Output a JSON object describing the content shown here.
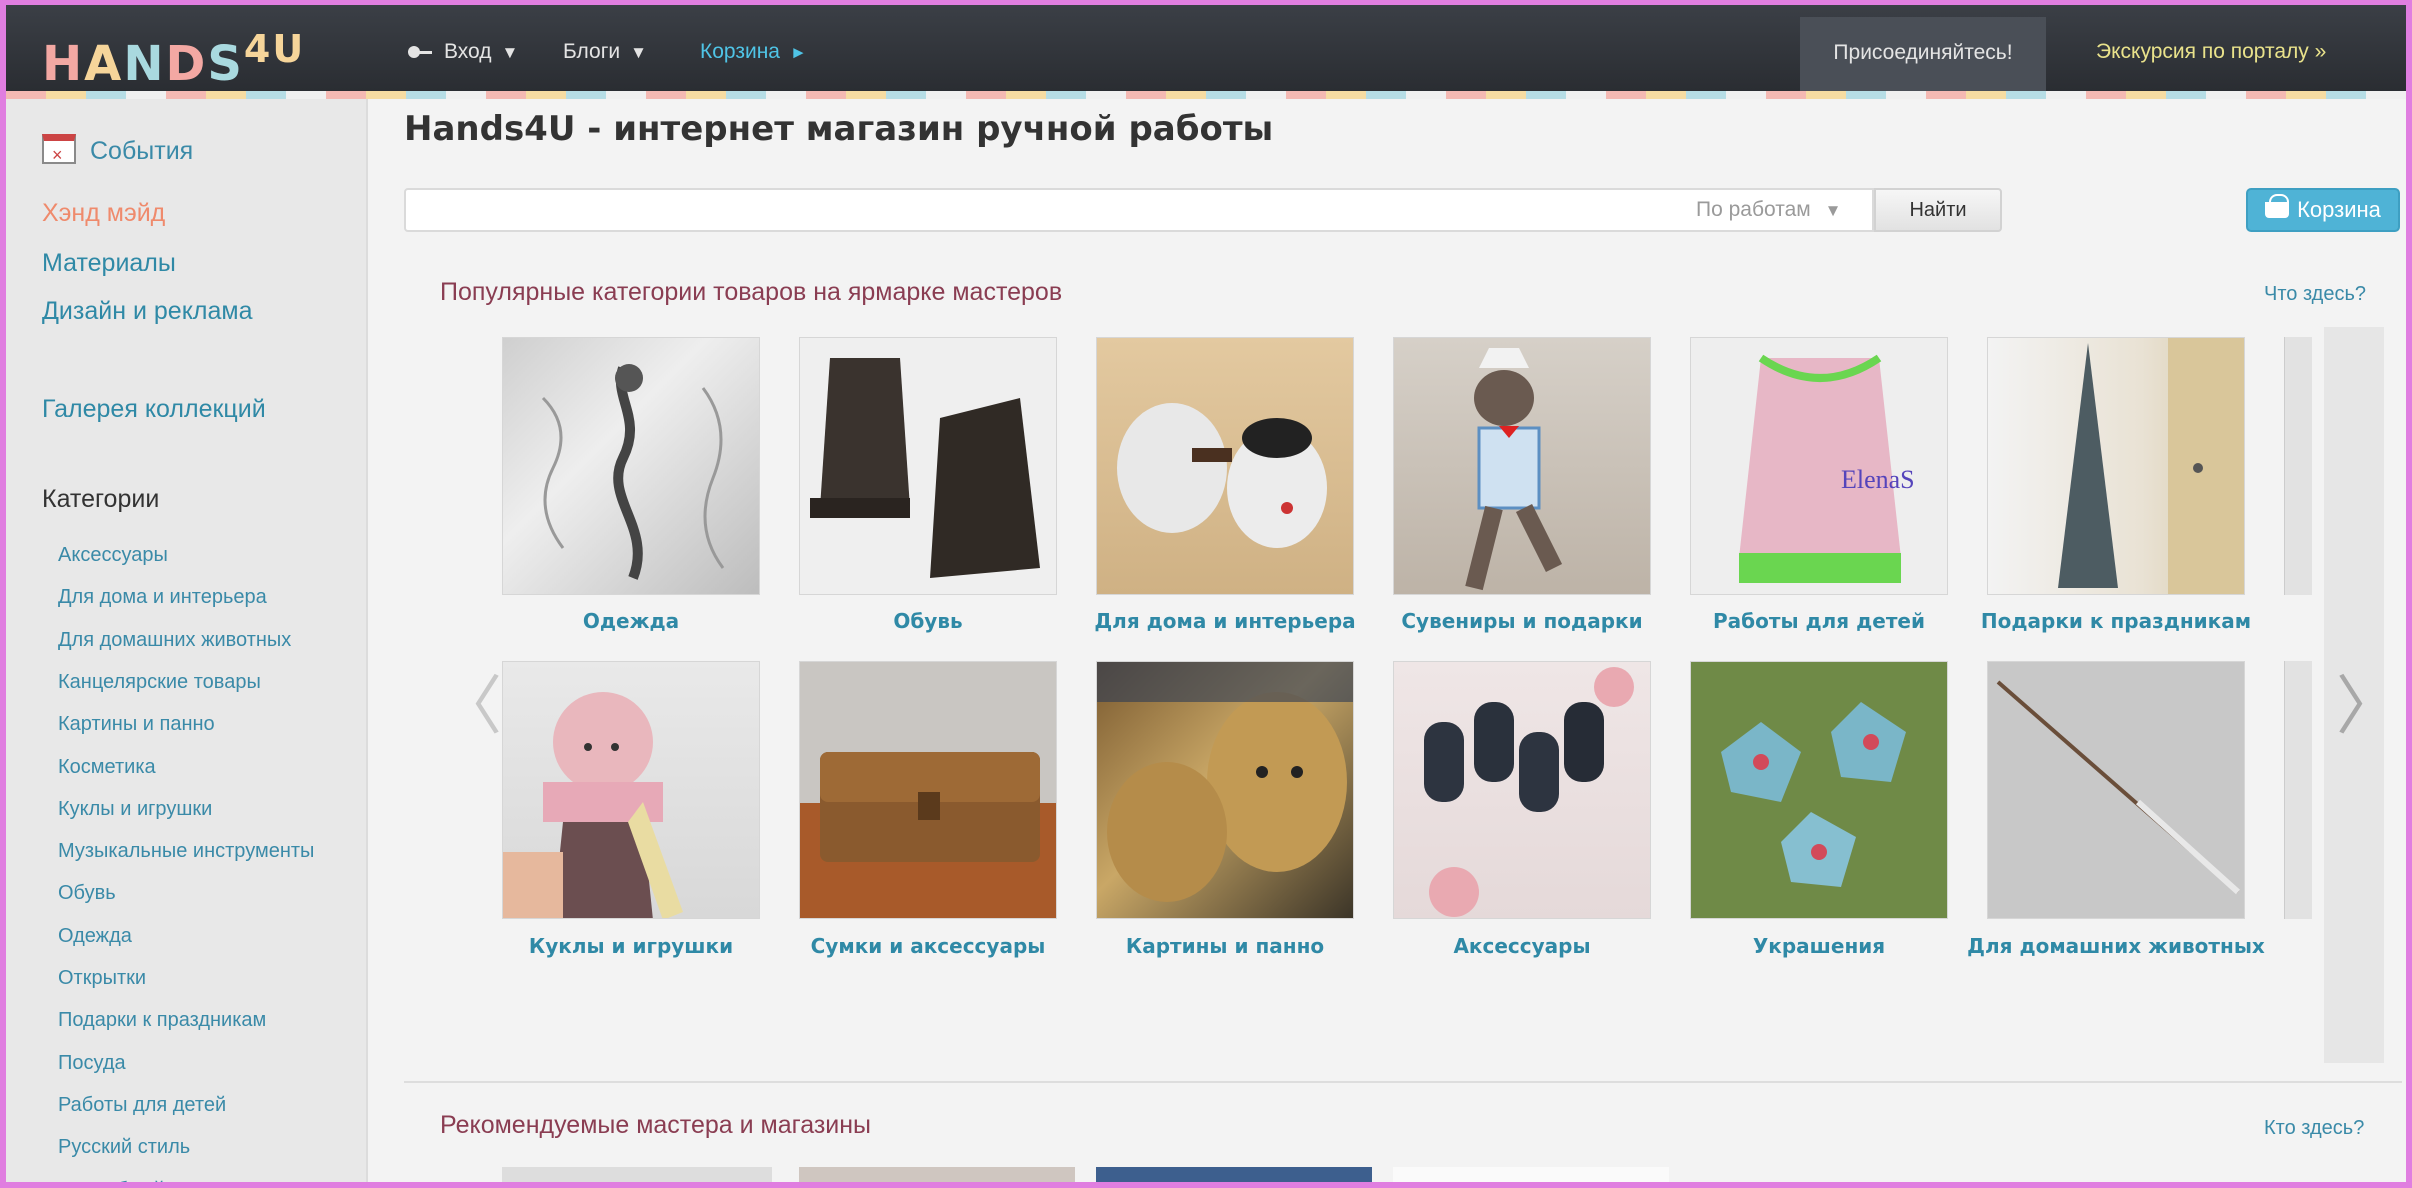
{
  "header": {
    "logo_text": "HANDS",
    "logo_suffix": "4U",
    "login_label": "Вход",
    "blogs_label": "Блоги",
    "cart_label": "Корзина",
    "join_label": "Присоединяйтесь!",
    "tour_label": "Экскурсия по порталу »"
  },
  "sidebar": {
    "events_label": "События",
    "links": [
      "Хэнд мэйд",
      "Материалы",
      "Дизайн и реклама"
    ],
    "gallery_label": "Галерея коллекций",
    "categories_heading": "Категории",
    "categories": [
      "Аксессуары",
      "Для дома и интерьера",
      "Для домашних животных",
      "Канцелярские товары",
      "Картины и панно",
      "Косметика",
      "Куклы и игрушки",
      "Музыкальные инструменты",
      "Обувь",
      "Одежда",
      "Открытки",
      "Подарки к праздникам",
      "Посуда",
      "Работы для детей",
      "Русский стиль",
      "Свадебный салон"
    ]
  },
  "main": {
    "title": "Hands4U - интернет магазин ручной работы",
    "search": {
      "value": "",
      "placeholder": "",
      "scope_label": "По работам",
      "button_label": "Найти"
    },
    "cart_button_label": "Корзина",
    "popular": {
      "title": "Популярные категории товаров на ярмарке мастеров",
      "help_label": "Что здесь?",
      "row1": [
        "Одежда",
        "Обувь",
        "Для дома и интерьера",
        "Сувениры и подарки",
        "Работы для детей",
        "Подарки к праздникам"
      ],
      "row2": [
        "Куклы и игрушки",
        "Сумки и аксессуары",
        "Картины и панно",
        "Аксессуары",
        "Украшения",
        "Для домашних животных"
      ],
      "prev_symbol": "〈",
      "next_symbol": "〉"
    },
    "recommended": {
      "title": "Рекомендуемые мастера и магазины",
      "help_label": "Кто здесь?"
    }
  },
  "colors": {
    "accent": "#2f89a6",
    "active_link": "#ef8a6c",
    "section_title": "#8a3d52",
    "cart_button": "#4fb3d6",
    "tour_link": "#e9e28b",
    "header_bg": "#2a2d32"
  }
}
